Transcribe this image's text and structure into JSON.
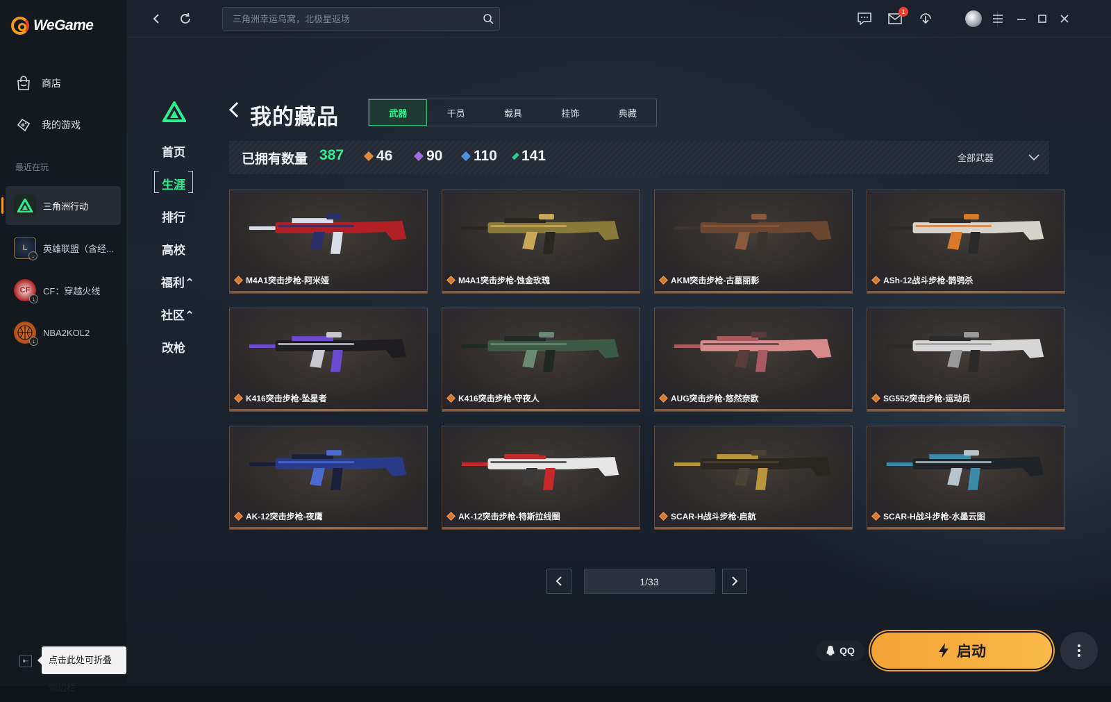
{
  "app": {
    "name": "WeGame"
  },
  "sidebar": {
    "nav": [
      {
        "label": "商店",
        "icon": "shop-bag-icon"
      },
      {
        "label": "我的游戏",
        "icon": "gamepad-icon"
      }
    ],
    "recent_title": "最近在玩",
    "recent": [
      {
        "label": "三角洲行动",
        "icon": "delta-force-icon",
        "active": true
      },
      {
        "label": "英雄联盟（含经...",
        "icon": "league-of-legends-icon"
      },
      {
        "label": "CF：穿越火线",
        "icon": "crossfire-icon"
      },
      {
        "label": "NBA2KOL2",
        "icon": "basketball-icon"
      }
    ],
    "collapse_tooltip": "点击此处可折叠侧边栏"
  },
  "topbar": {
    "search_placeholder": "三角洲幸运鸟窝，北极星返场",
    "mail_badge": "1"
  },
  "game_nav": [
    {
      "label": "首页"
    },
    {
      "label": "生涯",
      "active": true
    },
    {
      "label": "排行"
    },
    {
      "label": "高校"
    },
    {
      "label": "福利⌃"
    },
    {
      "label": "社区⌃"
    },
    {
      "label": "改枪"
    }
  ],
  "page": {
    "title": "我的藏品",
    "tabs": [
      {
        "label": "武器",
        "active": true
      },
      {
        "label": "干员"
      },
      {
        "label": "载具"
      },
      {
        "label": "挂饰"
      },
      {
        "label": "典藏"
      }
    ]
  },
  "stats": {
    "owned_label": "已拥有数量",
    "owned_count": "387",
    "rarities": [
      {
        "count": "46",
        "color": "#e08a3c"
      },
      {
        "count": "90",
        "color": "#a06be0"
      },
      {
        "count": "110",
        "color": "#4d8fe0"
      },
      {
        "count": "141",
        "color": "#2fd08a"
      }
    ],
    "filter_label": "全部武器"
  },
  "items": [
    {
      "name": "M4A1突击步枪-阿米娅",
      "palette": [
        "#b21f25",
        "#d8dde6",
        "#2b2f6a"
      ]
    },
    {
      "name": "M4A1突击步枪-蚀金玫瑰",
      "palette": [
        "#8a7a3a",
        "#2a2620",
        "#c9a85a"
      ]
    },
    {
      "name": "AKM突击步枪-古墓丽影",
      "palette": [
        "#6b4630",
        "#3a3330",
        "#8a5a3c"
      ]
    },
    {
      "name": "ASh-12战斗步枪-鹊鸮杀",
      "palette": [
        "#d6d2cc",
        "#2a2a2a",
        "#d97a2a"
      ]
    },
    {
      "name": "K416突击步枪-坠星者",
      "palette": [
        "#1d1d22",
        "#6a4ad0",
        "#c8c8d0"
      ]
    },
    {
      "name": "K416突击步枪-守夜人",
      "palette": [
        "#3d5a48",
        "#1f2a24",
        "#6a8a74"
      ]
    },
    {
      "name": "AUG突击步枪-悠然奈欧",
      "palette": [
        "#d88a8a",
        "#a85a60",
        "#5a3c3c"
      ]
    },
    {
      "name": "SG552突击步枪-运动员",
      "palette": [
        "#d6d6d6",
        "#2a2a2a",
        "#9a9a9a"
      ]
    },
    {
      "name": "AK-12突击步枪-夜鹰",
      "palette": [
        "#2a3a8a",
        "#1a1f3a",
        "#4a6ad0"
      ]
    },
    {
      "name": "AK-12突击步枪-特斯拉线圈",
      "palette": [
        "#e6e6e6",
        "#c8282a",
        "#3a3a3a"
      ]
    },
    {
      "name": "SCAR-H战斗步枪-启航",
      "palette": [
        "#2a2620",
        "#b8953a",
        "#4a4232"
      ]
    },
    {
      "name": "SCAR-H战斗步枪-水墨云图",
      "palette": [
        "#202428",
        "#3a8aa8",
        "#b8c4cc"
      ]
    }
  ],
  "pagination": {
    "current": "1/33"
  },
  "actions": {
    "qq_label": "QQ",
    "launch_label": "启动"
  }
}
